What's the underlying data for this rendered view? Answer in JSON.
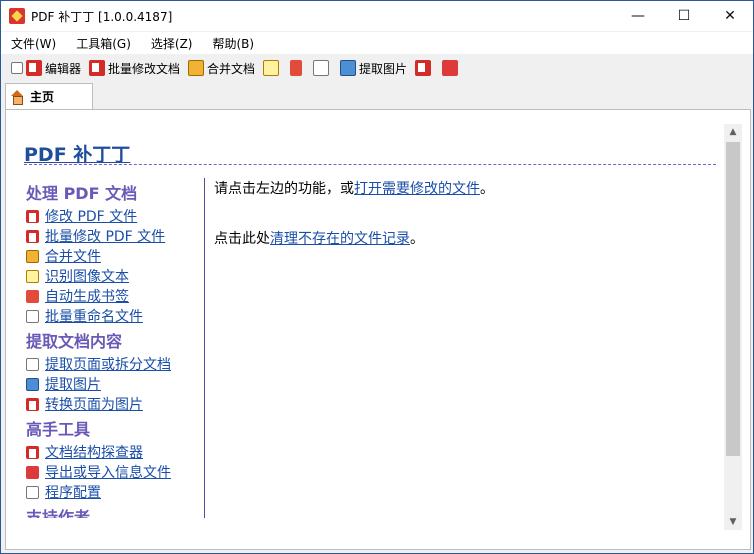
{
  "window": {
    "title": "PDF 补丁丁 [1.0.0.4187]",
    "minimize_glyph": "—",
    "maximize_glyph": "☐",
    "close_glyph": "✕"
  },
  "menu": [
    "文件(W)",
    "工具箱(G)",
    "选择(Z)",
    "帮助(B)"
  ],
  "toolbar": {
    "items": [
      {
        "label": "编辑器",
        "icon": "pdf-editor-icon"
      },
      {
        "label": "批量修改文档",
        "icon": "pdf-batch-icon"
      },
      {
        "label": "合并文档",
        "icon": "merge-icon"
      },
      {
        "label": "",
        "icon": "ocr-icon"
      },
      {
        "label": "",
        "icon": "bookmark-icon"
      },
      {
        "label": "",
        "icon": "rename-icon"
      },
      {
        "label": "提取图片",
        "icon": "image-extract-icon"
      },
      {
        "label": "",
        "icon": "pdf-convert-icon"
      },
      {
        "label": "",
        "icon": "export-icon"
      }
    ]
  },
  "tab": {
    "label": "主页"
  },
  "home": {
    "title": "PDF 补丁丁",
    "sections": [
      {
        "header": "处理 PDF 文档",
        "links": [
          "修改 PDF 文件",
          "批量修改 PDF 文件",
          "合并文件",
          "识别图像文本",
          "自动生成书签",
          "批量重命名文件"
        ]
      },
      {
        "header": "提取文档内容",
        "links": [
          "提取页面或拆分文档",
          "提取图片",
          "转换页面为图片"
        ]
      },
      {
        "header": "高手工具",
        "links": [
          "文档结构探查器",
          "导出或导入信息文件",
          "程序配置"
        ]
      },
      {
        "header": "支持作者",
        "links": []
      }
    ],
    "right": {
      "line1_prefix": "请点击左边的功能，或",
      "line1_link": "打开需要修改的文件",
      "line1_suffix": "。",
      "line2_prefix": "点击此处 ",
      "line2_link": "清理不存在的文件记录",
      "line2_suffix": "。"
    }
  },
  "colors": {
    "accent": "#1f4e9c",
    "section": "#6a59b6",
    "link": "#1a4ea8"
  }
}
